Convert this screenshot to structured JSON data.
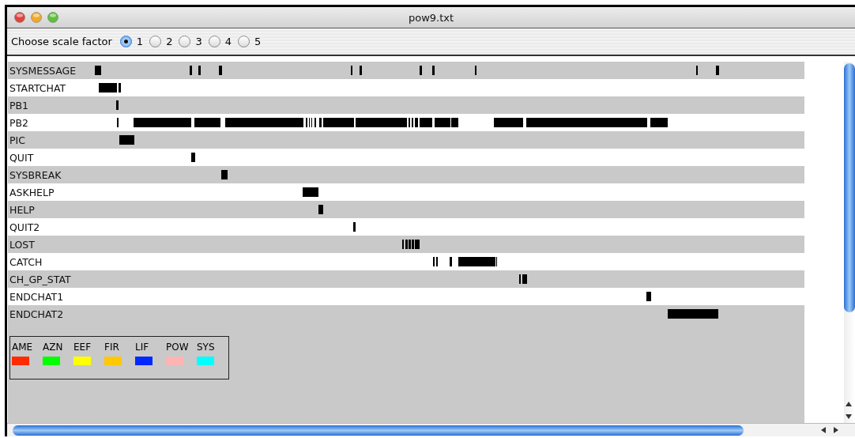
{
  "window": {
    "title": "pow9.txt"
  },
  "toolbar": {
    "label": "Choose scale factor",
    "options": [
      {
        "label": "1",
        "selected": true
      },
      {
        "label": "2",
        "selected": false
      },
      {
        "label": "3",
        "selected": false
      },
      {
        "label": "4",
        "selected": false
      },
      {
        "label": "5",
        "selected": false
      }
    ]
  },
  "rows": [
    {
      "name": "SYSMESSAGE"
    },
    {
      "name": "STARTCHAT"
    },
    {
      "name": "PB1"
    },
    {
      "name": "PB2"
    },
    {
      "name": "PIC"
    },
    {
      "name": "QUIT"
    },
    {
      "name": "SYSBREAK"
    },
    {
      "name": "ASKHELP"
    },
    {
      "name": "HELP"
    },
    {
      "name": "QUIT2"
    },
    {
      "name": "LOST"
    },
    {
      "name": "CATCH"
    },
    {
      "name": "CH_GP_STAT"
    },
    {
      "name": "ENDCHAT1"
    },
    {
      "name": "ENDCHAT2"
    }
  ],
  "legend": [
    {
      "label": "AME",
      "color": "#ff2a00"
    },
    {
      "label": "AZN",
      "color": "#00ff00"
    },
    {
      "label": "EEF",
      "color": "#ffff00"
    },
    {
      "label": "FIR",
      "color": "#ffc800"
    },
    {
      "label": "LIF",
      "color": "#0028ff"
    },
    {
      "label": "POW",
      "color": "#ffb4b4"
    },
    {
      "label": "SYS",
      "color": "#00ffff"
    }
  ]
}
